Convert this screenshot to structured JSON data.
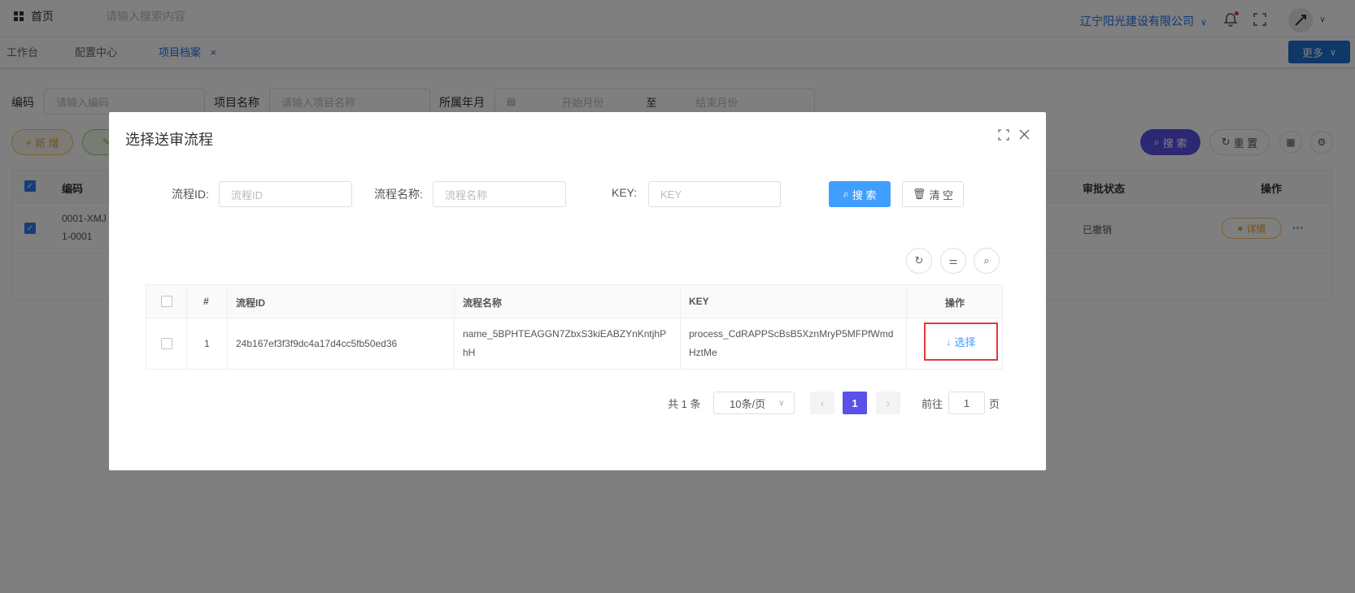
{
  "header": {
    "home_label": "首页",
    "search_placeholder": "请输入搜索内容",
    "company": "辽宁阳光建设有限公司",
    "company_chevron": "∨"
  },
  "tabs": {
    "workbench": "工作台",
    "config": "配置中心",
    "archive": "项目档案",
    "archive_close": "×",
    "more_label": "更多"
  },
  "filters": {
    "code_label": "编码",
    "code_placeholder": "请输入编码",
    "name_label": "项目名称",
    "name_placeholder": "请输入项目名称",
    "month_label": "所属年月",
    "start_placeholder": "开始月份",
    "range_sep": "至",
    "end_placeholder": "结束月份"
  },
  "actions": {
    "add_label": "新 增",
    "search_label": "搜 索",
    "reset_label": "重 置"
  },
  "bg_table": {
    "col_code": "编码",
    "col_status": "审批状态",
    "col_ops": "操作",
    "row_code_line1": "0001-XMJ",
    "row_code_line2": "1-0001",
    "row_status": "已撤销",
    "row_detail": "详情",
    "row_more": "···"
  },
  "dialog": {
    "title": "选择送审流程",
    "id_label": "流程ID:",
    "id_placeholder": "流程ID",
    "name_label": "流程名称:",
    "name_placeholder": "流程名称",
    "key_label": "KEY:",
    "key_placeholder": "KEY",
    "search_label": "搜 索",
    "clear_label": "清 空",
    "table": {
      "headers": [
        "#",
        "流程ID",
        "流程名称",
        "KEY",
        "操作"
      ],
      "rows": [
        {
          "index": "1",
          "id": "24b167ef3f3f9dc4a17d4cc5fb50ed36",
          "name_line1": "name_5BPHTEAGGN7ZbxS3kiEABZYnKntjhP",
          "name_line2": "hH",
          "key_line1": "process_CdRAPPScBsB5XznMryP5MFPfWmd",
          "key_line2": "HztMe",
          "action_icon": "↓",
          "action_label": "选择"
        }
      ]
    },
    "pagination": {
      "total_label": "共 1 条",
      "page_size": "10条/页",
      "current_page": "1",
      "goto_label": "前往",
      "goto_value": "1",
      "page_suffix": "页"
    }
  },
  "colors": {
    "primary": "#409eff",
    "brand_dark": "#1f6fd0",
    "purple": "#5b50e8",
    "highlight": "#e53935"
  }
}
